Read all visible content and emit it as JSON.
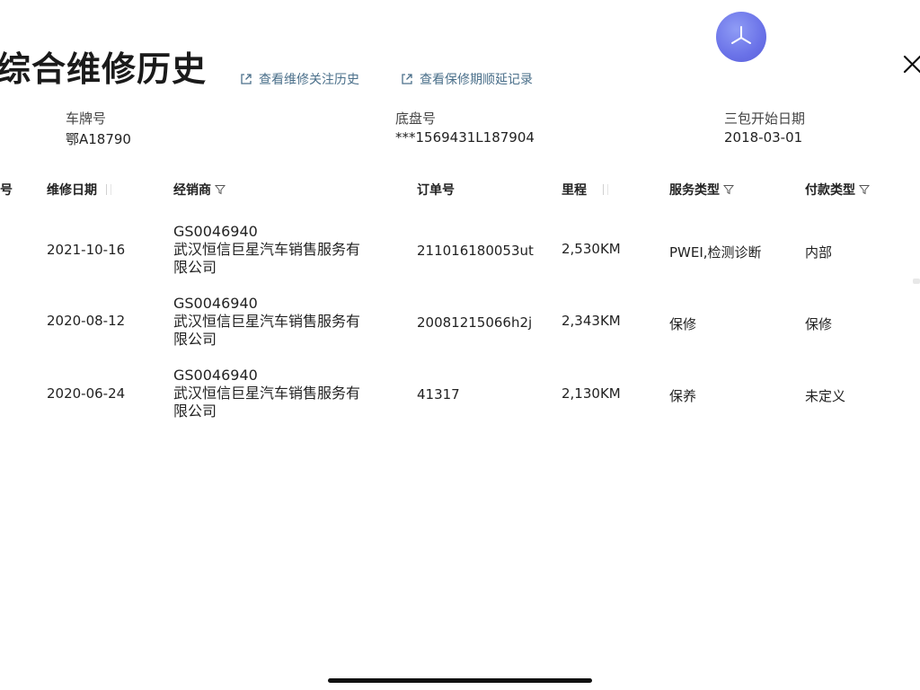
{
  "page": {
    "title": "综合维修历史",
    "links": [
      {
        "label": "查看维修关注历史",
        "icon": "external-link-icon"
      },
      {
        "label": "查看保修期顺延记录",
        "icon": "external-link-icon"
      }
    ],
    "logo_icon": "star-logo-icon",
    "close_icon": "close-icon"
  },
  "vehicle": {
    "plate_label": "车牌号",
    "plate_value": "鄂A18790",
    "chassis_label": "底盘号",
    "chassis_value": "***1569431L187904",
    "warranty_label": "三包开始日期",
    "warranty_value": "2018-03-01"
  },
  "table": {
    "headers": {
      "seq": "序号",
      "date": "维修日期",
      "dealer": "经销商",
      "order": "订单号",
      "mileage": "里程",
      "service": "服务类型",
      "payment": "付款类型"
    },
    "rows": [
      {
        "date": "2021-10-16",
        "dealer_code": "GS0046940",
        "dealer_name_line1": "武汉恒信巨星汽车销售服务有",
        "dealer_name_line2": "限公司",
        "order": "211016180053ut",
        "mileage": "2,530KM",
        "service": "PWEI,检测诊断",
        "payment": "内部"
      },
      {
        "date": "2020-08-12",
        "dealer_code": "GS0046940",
        "dealer_name_line1": "武汉恒信巨星汽车销售服务有",
        "dealer_name_line2": "限公司",
        "order": "20081215066h2j",
        "mileage": "2,343KM",
        "service": "保修",
        "payment": "保修"
      },
      {
        "date": "2020-06-24",
        "dealer_code": "GS0046940",
        "dealer_name_line1": "武汉恒信巨星汽车销售服务有",
        "dealer_name_line2": "限公司",
        "order": "41317",
        "mileage": "2,130KM",
        "service": "保养",
        "payment": "未定义"
      }
    ]
  },
  "colors": {
    "link": "#4a6f8a",
    "logo": "#6a72e8",
    "text": "#222222"
  }
}
